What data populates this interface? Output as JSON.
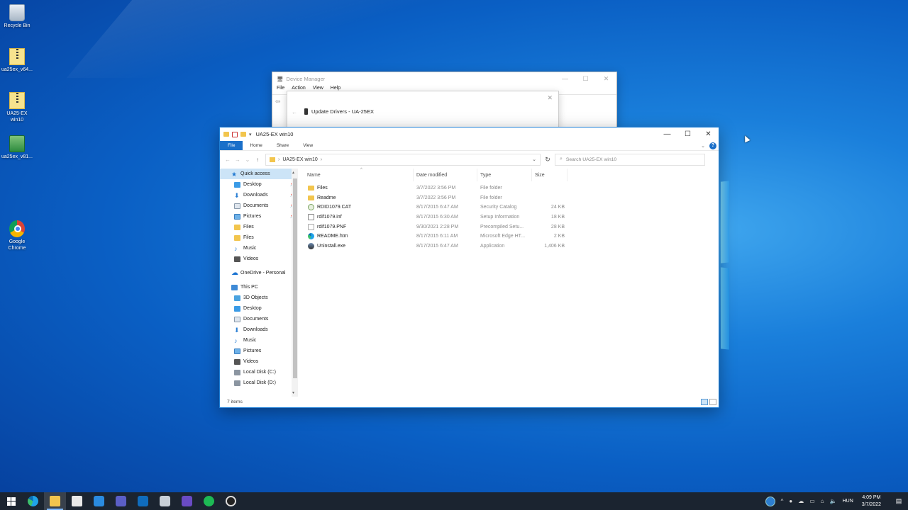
{
  "desktop": {
    "icons": [
      {
        "label": "Recycle Bin",
        "icon": "recycle-bin-icon"
      },
      {
        "label": "ua25ex_v64...",
        "icon": "zip-archive-icon"
      },
      {
        "label": "UA25-EX win10",
        "icon": "zip-folder-icon"
      },
      {
        "label": "ua25ex_v81...",
        "icon": "installer-icon"
      },
      {
        "label": "Google Chrome",
        "icon": "chrome-icon"
      }
    ]
  },
  "device_manager": {
    "title": "Device Manager",
    "menu": [
      "File",
      "Action",
      "View",
      "Help"
    ],
    "controls": {
      "minimize": "—",
      "maximize": "☐",
      "close": "✕"
    }
  },
  "update_dialog": {
    "title": "Update Drivers - UA-25EX",
    "close": "✕"
  },
  "explorer": {
    "title": "UA25-EX win10",
    "controls": {
      "minimize": "—",
      "maximize": "☐",
      "close": "✕"
    },
    "ribbon_tabs": [
      "File",
      "Home",
      "Share",
      "View"
    ],
    "address": {
      "segment": "UA25-EX win10",
      "separator": "›"
    },
    "search_placeholder": "Search UA25-EX win10",
    "nav": {
      "quick_access": "Quick access",
      "quick_items": [
        {
          "label": "Desktop",
          "icon": "desktop-icon",
          "pinned": true
        },
        {
          "label": "Downloads",
          "icon": "downloads-icon",
          "pinned": true
        },
        {
          "label": "Documents",
          "icon": "documents-icon",
          "pinned": true
        },
        {
          "label": "Pictures",
          "icon": "pictures-icon",
          "pinned": true
        },
        {
          "label": "Files",
          "icon": "folder-icon",
          "pinned": false
        },
        {
          "label": "Files",
          "icon": "folder-icon",
          "pinned": false
        },
        {
          "label": "Music",
          "icon": "music-icon",
          "pinned": false
        },
        {
          "label": "Videos",
          "icon": "videos-icon",
          "pinned": false
        }
      ],
      "onedrive": "OneDrive - Personal",
      "this_pc": "This PC",
      "pc_items": [
        {
          "label": "3D Objects",
          "icon": "3d-objects-icon"
        },
        {
          "label": "Desktop",
          "icon": "desktop-icon"
        },
        {
          "label": "Documents",
          "icon": "documents-icon"
        },
        {
          "label": "Downloads",
          "icon": "downloads-icon"
        },
        {
          "label": "Music",
          "icon": "music-icon"
        },
        {
          "label": "Pictures",
          "icon": "pictures-icon"
        },
        {
          "label": "Videos",
          "icon": "videos-icon"
        },
        {
          "label": "Local Disk (C:)",
          "icon": "disk-icon"
        },
        {
          "label": "Local Disk (D:)",
          "icon": "disk-icon"
        }
      ]
    },
    "columns": [
      "Name",
      "Date modified",
      "Type",
      "Size"
    ],
    "files": [
      {
        "name": "Files",
        "date": "3/7/2022 3:56 PM",
        "type": "File folder",
        "size": "",
        "icon": "folder"
      },
      {
        "name": "Readme",
        "date": "3/7/2022 3:56 PM",
        "type": "File folder",
        "size": "",
        "icon": "folder"
      },
      {
        "name": "RDID1079.CAT",
        "date": "8/17/2015 6:47 AM",
        "type": "Security Catalog",
        "size": "24 KB",
        "icon": "cat"
      },
      {
        "name": "rdif1079.inf",
        "date": "8/17/2015 6:30 AM",
        "type": "Setup Information",
        "size": "18 KB",
        "icon": "inf"
      },
      {
        "name": "rdif1079.PNF",
        "date": "9/30/2021 2:28 PM",
        "type": "Precompiled Setu...",
        "size": "28 KB",
        "icon": "pnf"
      },
      {
        "name": "README.htm",
        "date": "8/17/2015 6:11 AM",
        "type": "Microsoft Edge HT...",
        "size": "2 KB",
        "icon": "edge"
      },
      {
        "name": "Uninstall.exe",
        "date": "8/17/2015 6:47 AM",
        "type": "Application",
        "size": "1,406 KB",
        "icon": "exe"
      }
    ],
    "status": "7 items"
  },
  "taskbar": {
    "apps": [
      "edge-icon",
      "file-explorer-icon",
      "store-icon",
      "mail-icon",
      "teams-icon",
      "outlook-icon",
      "terminal-icon",
      "teams-classic-icon",
      "spotify-icon",
      "obs-icon"
    ],
    "language": "HUN",
    "time": "4:09 PM",
    "date": "3/7/2022"
  }
}
